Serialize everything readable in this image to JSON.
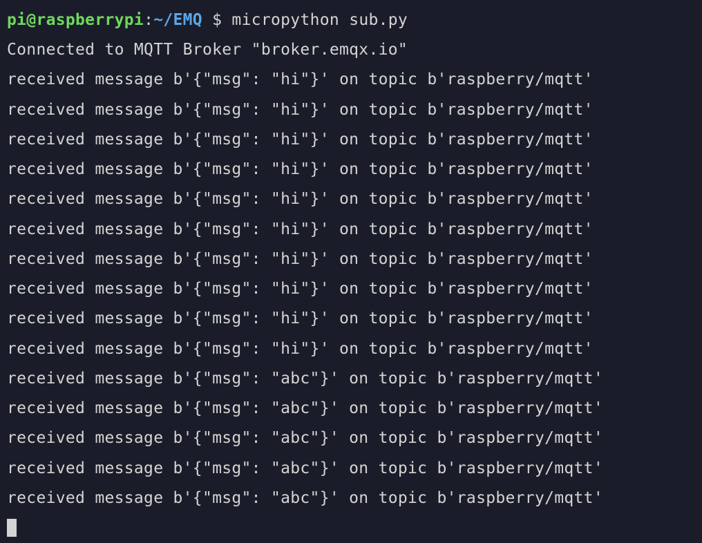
{
  "prompt": {
    "user_host": "pi@raspberrypi",
    "colon": ":",
    "path": "~/EMQ",
    "dollar": " $ ",
    "command": "micropython sub.py"
  },
  "connected_line": "Connected to MQTT Broker \"broker.emqx.io\"",
  "received_lines": [
    "received message b'{\"msg\": \"hi\"}' on topic b'raspberry/mqtt'",
    "received message b'{\"msg\": \"hi\"}' on topic b'raspberry/mqtt'",
    "received message b'{\"msg\": \"hi\"}' on topic b'raspberry/mqtt'",
    "received message b'{\"msg\": \"hi\"}' on topic b'raspberry/mqtt'",
    "received message b'{\"msg\": \"hi\"}' on topic b'raspberry/mqtt'",
    "received message b'{\"msg\": \"hi\"}' on topic b'raspberry/mqtt'",
    "received message b'{\"msg\": \"hi\"}' on topic b'raspberry/mqtt'",
    "received message b'{\"msg\": \"hi\"}' on topic b'raspberry/mqtt'",
    "received message b'{\"msg\": \"hi\"}' on topic b'raspberry/mqtt'",
    "received message b'{\"msg\": \"hi\"}' on topic b'raspberry/mqtt'",
    "received message b'{\"msg\": \"abc\"}' on topic b'raspberry/mqtt'",
    "received message b'{\"msg\": \"abc\"}' on topic b'raspberry/mqtt'",
    "received message b'{\"msg\": \"abc\"}' on topic b'raspberry/mqtt'",
    "received message b'{\"msg\": \"abc\"}' on topic b'raspberry/mqtt'",
    "received message b'{\"msg\": \"abc\"}' on topic b'raspberry/mqtt'"
  ]
}
